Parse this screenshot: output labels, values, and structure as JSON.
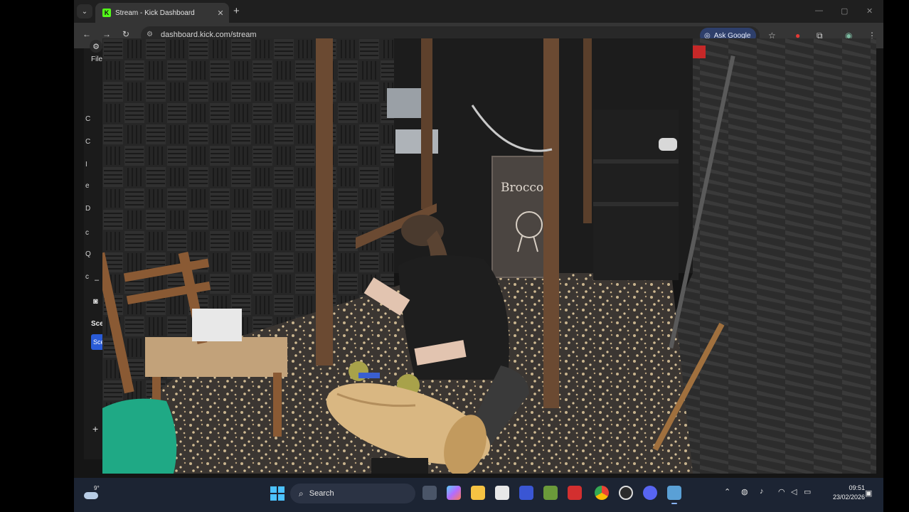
{
  "browser": {
    "tab_title": "Stream - Kick Dashboard",
    "tab_favicon": "K",
    "url": "dashboard.kick.com/stream",
    "ask_google_label": "Ask Google",
    "new_tab_glyph": "+",
    "close_tab_glyph": "✕"
  },
  "dashboard": {
    "file_menu": "File",
    "side_letters": [
      "C",
      "C",
      "I",
      "e",
      "D",
      "c",
      "Q",
      "c"
    ],
    "scenes_heading": "Sce",
    "scene_item": "Sce",
    "add_glyph": "+"
  },
  "video": {
    "chalkboard_text": "Broccoli",
    "colors": {
      "foam": "#2a2a2a",
      "wood": "#6b4a32",
      "log": "#d9b782"
    }
  },
  "taskbar": {
    "weather_temp": "9°",
    "search_placeholder": "Search",
    "time": "09:51",
    "date": "23/02/2026",
    "apps": [
      "task-view",
      "copilot",
      "file-explorer",
      "calendar",
      "zoom",
      "minecraft",
      "roblox",
      "chrome",
      "obs",
      "discord",
      "screen-app"
    ]
  },
  "accent": {
    "kick_green": "#53fc18",
    "windows_blue": "#4cc2ff"
  }
}
